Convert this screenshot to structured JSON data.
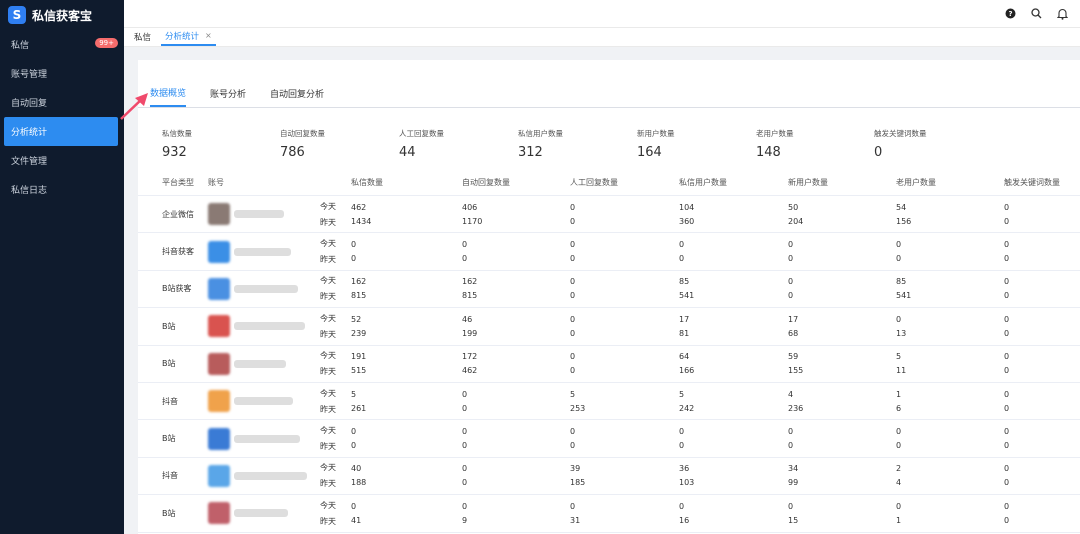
{
  "app": {
    "title": "私信获客宝",
    "logo_mark": "S"
  },
  "sidebar": {
    "items": [
      {
        "label": "私信",
        "badge": "99+"
      },
      {
        "label": "账号管理"
      },
      {
        "label": "自动回复"
      },
      {
        "label": "分析统计",
        "active": true
      },
      {
        "label": "文件管理"
      },
      {
        "label": "私信日志"
      }
    ]
  },
  "topbar": {
    "icons": [
      "help-icon",
      "search-icon",
      "bell-icon"
    ]
  },
  "page_tabs": [
    {
      "label": "私信"
    },
    {
      "label": "分析统计",
      "active": true,
      "close": "×"
    }
  ],
  "subtabs": [
    {
      "label": "数据概览",
      "active": true
    },
    {
      "label": "账号分析"
    },
    {
      "label": "自动回复分析"
    }
  ],
  "stats": [
    {
      "label": "私信数量",
      "value": "932"
    },
    {
      "label": "自动回复数量",
      "value": "786"
    },
    {
      "label": "人工回复数量",
      "value": "44"
    },
    {
      "label": "私信用户数量",
      "value": "312"
    },
    {
      "label": "新用户数量",
      "value": "164"
    },
    {
      "label": "老用户数量",
      "value": "148"
    },
    {
      "label": "触发关键词数量",
      "value": "0"
    }
  ],
  "table": {
    "headers": [
      "平台类型",
      "账号",
      "私信数量",
      "自动回复数量",
      "人工回复数量",
      "私信用户数量",
      "新用户数量",
      "老用户数量",
      "触发关键词数量"
    ],
    "day_labels": [
      "今天",
      "昨天"
    ],
    "rows": [
      {
        "platform": "企业微信",
        "avatar": "#8a7a74",
        "today": [
          "462",
          "406",
          "0",
          "104",
          "50",
          "54",
          "0"
        ],
        "yesterday": [
          "1434",
          "1170",
          "0",
          "360",
          "204",
          "156",
          "0"
        ]
      },
      {
        "platform": "抖音获客",
        "avatar": "#3b8fe6",
        "today": [
          "0",
          "0",
          "0",
          "0",
          "0",
          "0",
          "0"
        ],
        "yesterday": [
          "0",
          "0",
          "0",
          "0",
          "0",
          "0",
          "0"
        ]
      },
      {
        "platform": "B站获客",
        "avatar": "#4a90e2",
        "today": [
          "162",
          "162",
          "0",
          "85",
          "0",
          "85",
          "0"
        ],
        "yesterday": [
          "815",
          "815",
          "0",
          "541",
          "0",
          "541",
          "0"
        ]
      },
      {
        "platform": "B站",
        "avatar": "#d9534f",
        "today": [
          "52",
          "46",
          "0",
          "17",
          "17",
          "0",
          "0"
        ],
        "yesterday": [
          "239",
          "199",
          "0",
          "81",
          "68",
          "13",
          "0"
        ]
      },
      {
        "platform": "B站",
        "avatar": "#b85c5c",
        "today": [
          "191",
          "172",
          "0",
          "64",
          "59",
          "5",
          "0"
        ],
        "yesterday": [
          "515",
          "462",
          "0",
          "166",
          "155",
          "11",
          "0"
        ]
      },
      {
        "platform": "抖音",
        "avatar": "#f0a24b",
        "today": [
          "5",
          "0",
          "5",
          "5",
          "4",
          "1",
          "0"
        ],
        "yesterday": [
          "261",
          "0",
          "253",
          "242",
          "236",
          "6",
          "0"
        ]
      },
      {
        "platform": "B站",
        "avatar": "#3a7bd5",
        "today": [
          "0",
          "0",
          "0",
          "0",
          "0",
          "0",
          "0"
        ],
        "yesterday": [
          "0",
          "0",
          "0",
          "0",
          "0",
          "0",
          "0"
        ]
      },
      {
        "platform": "抖音",
        "avatar": "#5aa6e8",
        "today": [
          "40",
          "0",
          "39",
          "36",
          "34",
          "2",
          "0"
        ],
        "yesterday": [
          "188",
          "0",
          "185",
          "103",
          "99",
          "4",
          "0"
        ]
      },
      {
        "platform": "B站",
        "avatar": "#c0606a",
        "today": [
          "0",
          "0",
          "0",
          "0",
          "0",
          "0",
          "0"
        ],
        "yesterday": [
          "41",
          "9",
          "31",
          "16",
          "15",
          "1",
          "0"
        ]
      }
    ]
  }
}
